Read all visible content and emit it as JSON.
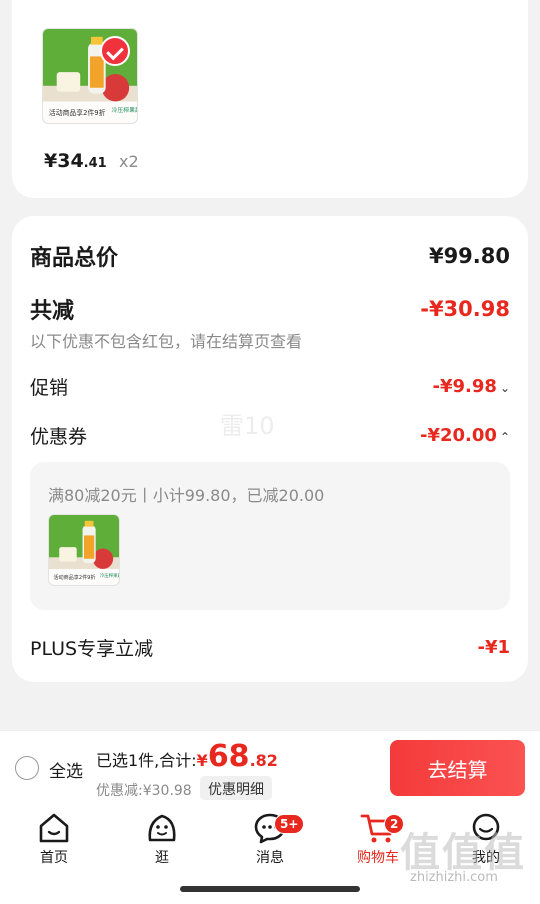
{
  "item": {
    "price_main": "¥34",
    "price_decimal": ".41",
    "quantity": "x2",
    "thumb_banner": "活动商品享2件9折",
    "thumb_tag": "冷压榨果蔬"
  },
  "summary": {
    "total_label": "商品总价",
    "total_value": "¥99.80",
    "reduce_label": "共减",
    "reduce_value": "-¥30.98",
    "note": "以下优惠不包含红包，请在结算页查看",
    "promo_label": "促销",
    "promo_value": "-¥9.98",
    "coupon_label": "优惠券",
    "coupon_value": "-¥20.00",
    "watermark": "雷10",
    "coupon_detail": "满80减20元丨小计99.80，已减20.00",
    "plus_label": "PLUS专享立减",
    "plus_value": "-¥1"
  },
  "checkout": {
    "select_all": "全选",
    "selected_prefix": "已选1件,合计:",
    "currency": "¥",
    "total_int": "68",
    "total_dec": ".82",
    "discount_text": "优惠减:¥30.98",
    "detail_button": "优惠明细",
    "checkout_button": "去结算"
  },
  "tabs": [
    {
      "label": "首页",
      "icon": "home-icon"
    },
    {
      "label": "逛",
      "icon": "stroll-icon"
    },
    {
      "label": "消息",
      "icon": "message-icon",
      "badge": "5+"
    },
    {
      "label": "购物车",
      "icon": "cart-icon",
      "badge": "2",
      "active": true
    },
    {
      "label": "我的",
      "icon": "profile-icon"
    }
  ],
  "watermark": {
    "big": "值值值",
    "small": "zhizhizhi.com"
  },
  "colors": {
    "accent_red": "#e8281f",
    "checkout_red": "#f43a3a",
    "background": "#f2f2f2"
  }
}
